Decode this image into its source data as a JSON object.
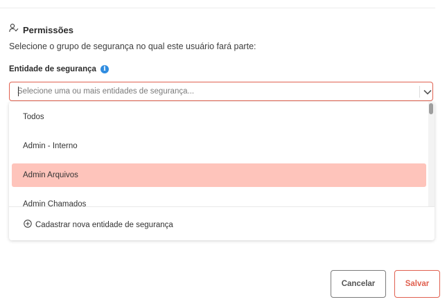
{
  "section": {
    "title": "Permissões",
    "icon": "user-check-icon",
    "subtitle": "Selecione o grupo de segurança no qual este usuário fará parte:"
  },
  "field": {
    "label": "Entidade de segurança",
    "info_icon": "info-icon",
    "placeholder": "Selecione uma ou mais entidades de segurança...",
    "value": ""
  },
  "dropdown": {
    "options": [
      {
        "label": "Todos",
        "selected": false
      },
      {
        "label": "Admin - Interno",
        "selected": false
      },
      {
        "label": "Admin Arquivos",
        "selected": true
      },
      {
        "label": "Admin Chamados",
        "selected": false
      }
    ],
    "add_label": "Cadastrar nova entidade de segurança",
    "add_icon": "plus-circle-icon"
  },
  "actions": {
    "cancel_label": "Cancelar",
    "save_label": "Salvar"
  },
  "colors": {
    "accent": "#e0604f",
    "selected_bg": "#fec4bb",
    "info": "#2f8ce0"
  }
}
